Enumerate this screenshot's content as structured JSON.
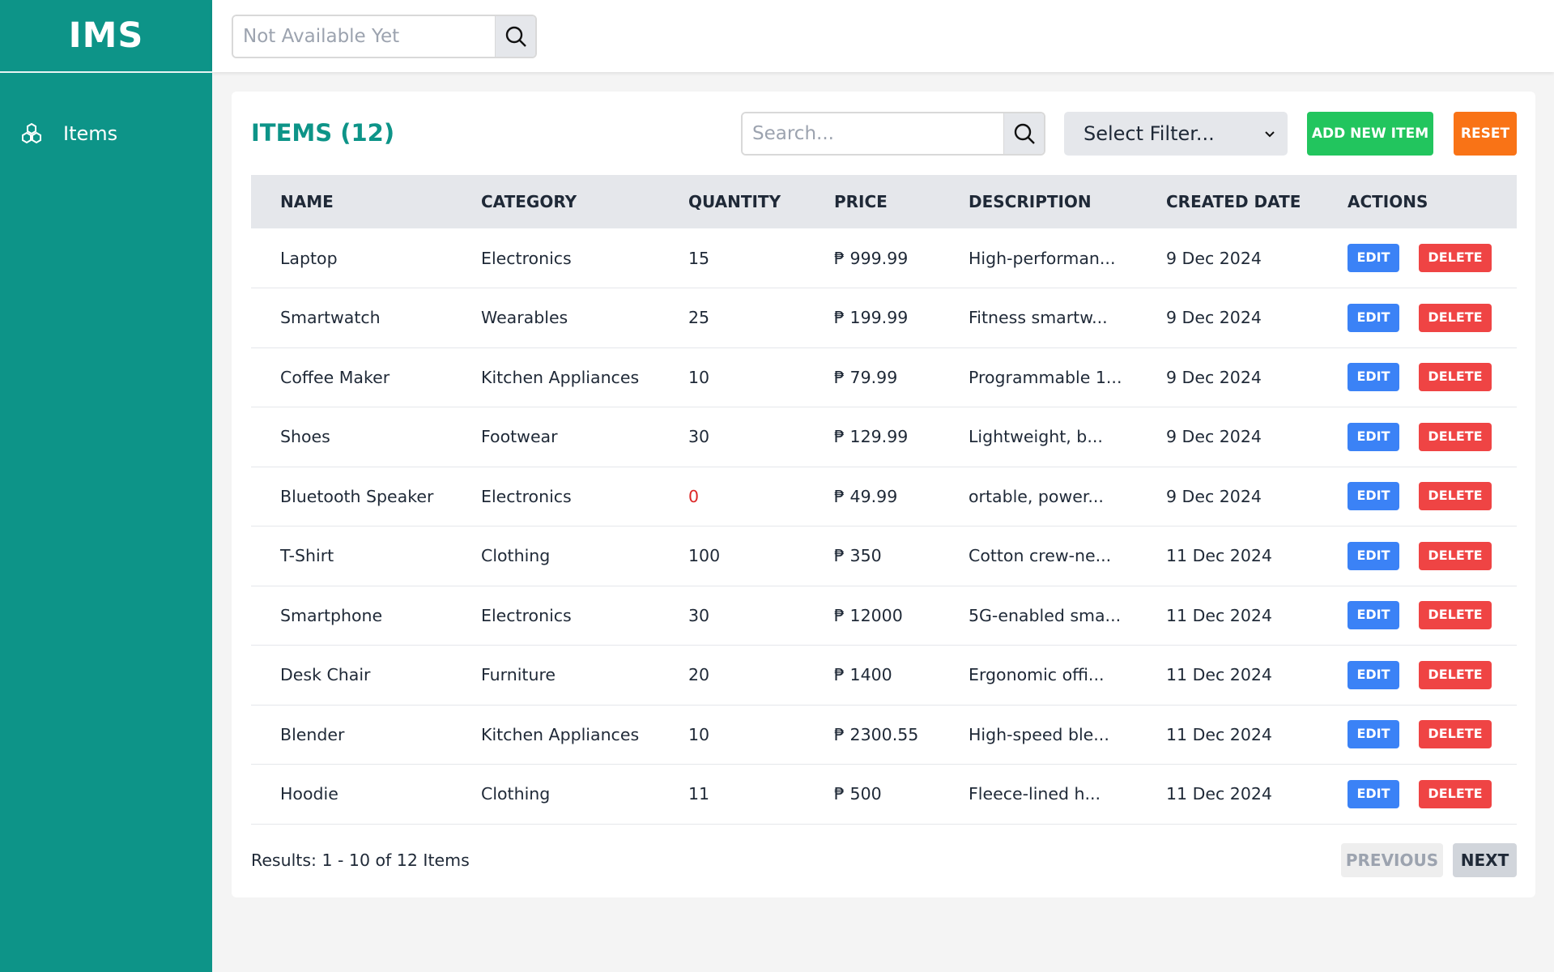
{
  "app": {
    "brand": "IMS"
  },
  "sidebar": {
    "items": [
      {
        "label": "Items",
        "icon": "cubes-icon"
      }
    ]
  },
  "topbar": {
    "search": {
      "placeholder": "Not Available Yet",
      "value": ""
    }
  },
  "main": {
    "title": "ITEMS (12)",
    "search": {
      "placeholder": "Search...",
      "value": ""
    },
    "filter": {
      "selected": "Select Filter..."
    },
    "add_label": "ADD NEW ITEM",
    "reset_label": "RESET",
    "columns": [
      "NAME",
      "CATEGORY",
      "QUANTITY",
      "PRICE",
      "DESCRIPTION",
      "CREATED DATE",
      "ACTIONS"
    ],
    "rows": [
      {
        "name": "Laptop",
        "category": "Electronics",
        "quantity": "15",
        "price": "₱ 999.99",
        "description": "High-performan...",
        "created": "9 Dec 2024"
      },
      {
        "name": "Smartwatch",
        "category": "Wearables",
        "quantity": "25",
        "price": "₱ 199.99",
        "description": "Fitness smartw...",
        "created": "9 Dec 2024"
      },
      {
        "name": "Coffee Maker",
        "category": "Kitchen Appliances",
        "quantity": "10",
        "price": "₱ 79.99",
        "description": "Programmable 1...",
        "created": "9 Dec 2024"
      },
      {
        "name": "Shoes",
        "category": "Footwear",
        "quantity": "30",
        "price": "₱ 129.99",
        "description": "Lightweight, b...",
        "created": "9 Dec 2024"
      },
      {
        "name": "Bluetooth Speaker",
        "category": "Electronics",
        "quantity": "0",
        "price": "₱ 49.99",
        "description": "ortable, power...",
        "created": "9 Dec 2024"
      },
      {
        "name": "T-Shirt",
        "category": "Clothing",
        "quantity": "100",
        "price": "₱ 350",
        "description": "Cotton crew-ne...",
        "created": "11 Dec 2024"
      },
      {
        "name": "Smartphone",
        "category": "Electronics",
        "quantity": "30",
        "price": "₱ 12000",
        "description": "5G-enabled sma...",
        "created": "11 Dec 2024"
      },
      {
        "name": "Desk Chair",
        "category": "Furniture",
        "quantity": "20",
        "price": "₱ 1400",
        "description": "Ergonomic offi...",
        "created": "11 Dec 2024"
      },
      {
        "name": "Blender",
        "category": "Kitchen Appliances",
        "quantity": "10",
        "price": "₱ 2300.55",
        "description": "High-speed ble...",
        "created": "11 Dec 2024"
      },
      {
        "name": "Hoodie",
        "category": "Clothing",
        "quantity": "11",
        "price": "₱ 500",
        "description": "Fleece-lined h...",
        "created": "11 Dec 2024"
      }
    ],
    "edit_label": "EDIT",
    "delete_label": "DELETE",
    "results_text": "Results: 1 - 10 of 12 Items",
    "prev_label": "PREVIOUS",
    "next_label": "NEXT"
  },
  "colors": {
    "sidebar": "#0d9488",
    "title": "#0d9488",
    "add": "#22c55e",
    "reset": "#f97316",
    "edit": "#3b82f6",
    "delete": "#ef4444",
    "zero_qty": "#dc2626"
  }
}
